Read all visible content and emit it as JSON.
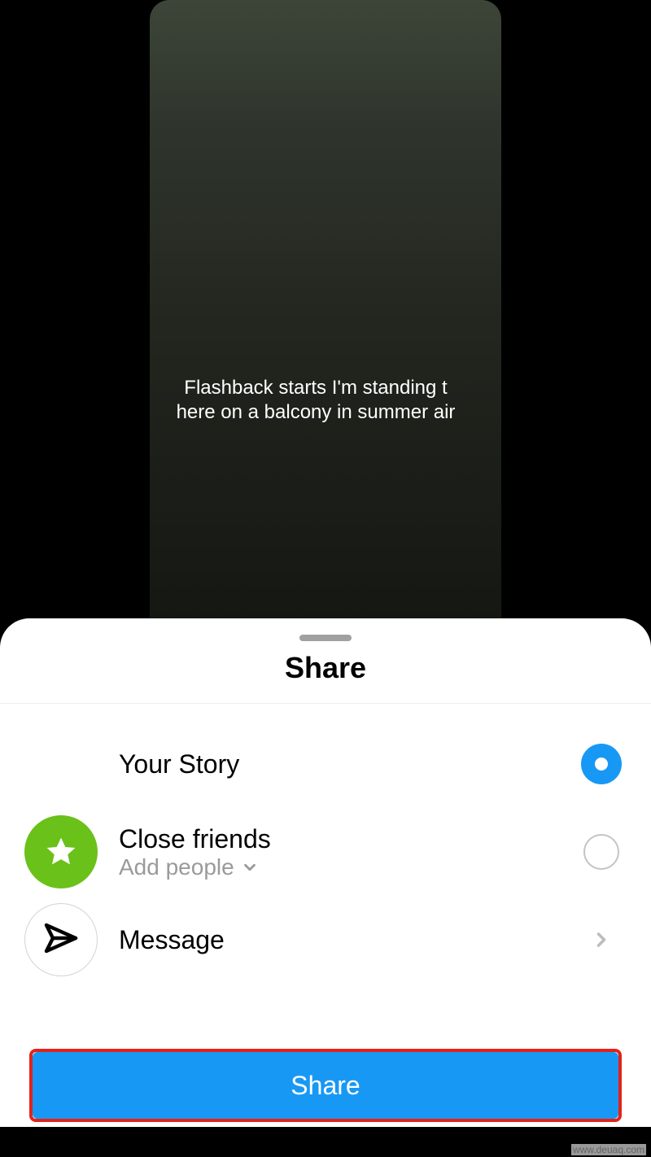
{
  "story": {
    "lyric_text": "Flashback starts I'm standing t here on a balcony in summer air"
  },
  "sheet": {
    "title": "Share",
    "options": {
      "your_story": {
        "label": "Your Story"
      },
      "close_friends": {
        "label": "Close friends",
        "sub": "Add people"
      },
      "message": {
        "label": "Message"
      }
    },
    "share_button": "Share"
  },
  "watermark": "www.deuaq.com"
}
